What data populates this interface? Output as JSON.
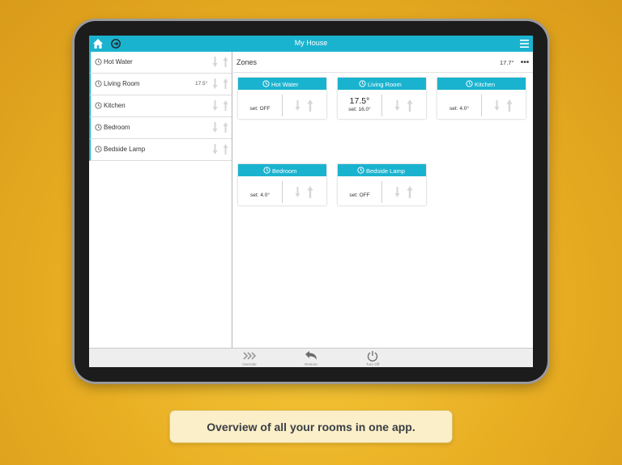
{
  "header": {
    "title": "My House",
    "icons": [
      "home-icon",
      "sync-icon",
      "menu-icon"
    ],
    "accent_color": "#1ab3cf"
  },
  "sidebar": {
    "items": [
      {
        "label": "Hot Water",
        "temp": ""
      },
      {
        "label": "Living Room",
        "temp": "17.5°"
      },
      {
        "label": "Kitchen",
        "temp": ""
      },
      {
        "label": "Bedroom",
        "temp": ""
      },
      {
        "label": "Bedside Lamp",
        "temp": ""
      }
    ]
  },
  "main": {
    "title": "Zones",
    "temp": "17.7°"
  },
  "zones": [
    {
      "name": "Hot Water",
      "current": "",
      "set": "set: OFF"
    },
    {
      "name": "Living Room",
      "current": "17.5°",
      "set": "set: 16.0°"
    },
    {
      "name": "Kitchen",
      "current": "",
      "set": "set: 4.0°"
    },
    {
      "name": "Bedroom",
      "current": "",
      "set": "set: 4.0°"
    },
    {
      "name": "Bedside Lamp",
      "current": "",
      "set": "set: OFF"
    }
  ],
  "bottombar": {
    "override": "Override",
    "restore": "Restore",
    "turn_off": "Turn Off"
  },
  "caption": "Overview of all your rooms in one app."
}
